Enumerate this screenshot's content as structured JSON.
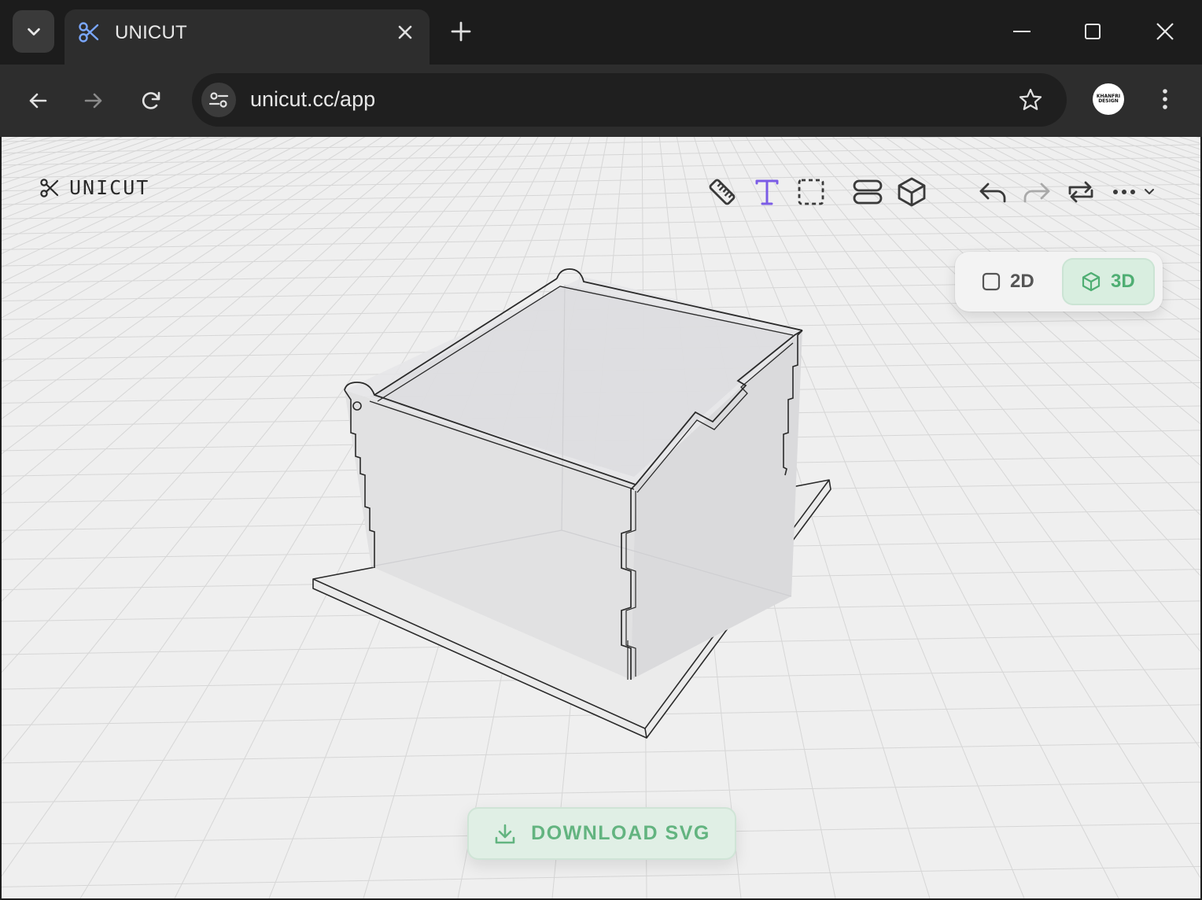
{
  "browser": {
    "tab": {
      "title": "UNICUT"
    },
    "address": {
      "url": "unicut.cc/app"
    },
    "profile": {
      "line1": "KHANFRI",
      "line2": "DESIGN"
    }
  },
  "app": {
    "brand": {
      "name": "UNICUT"
    },
    "toolbar": {
      "tools": [
        "ruler-icon",
        "text-icon",
        "selection-icon",
        "layers-icon",
        "box-icon"
      ],
      "actions": [
        "undo-icon",
        "redo-icon",
        "repeat-icon",
        "more-icon"
      ],
      "active_tool": "text"
    },
    "view_mode": {
      "options": [
        {
          "label": "2D",
          "active": false
        },
        {
          "label": "3D",
          "active": true
        }
      ]
    },
    "download_button": {
      "label": "DOWNLOAD SVG"
    }
  },
  "colors": {
    "accent_purple": "#7b5ce6",
    "accent_green": "#4fae73",
    "favicon_blue": "#7aa7ff",
    "grid_line": "#d6d6d6",
    "background": "#efefef"
  }
}
